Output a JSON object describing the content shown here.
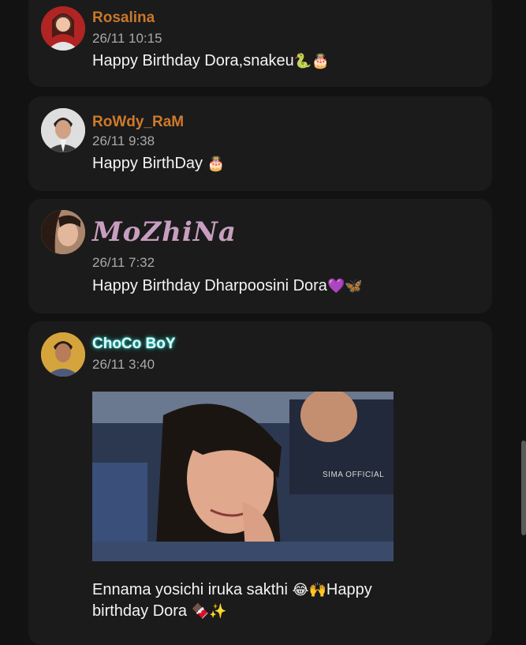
{
  "posts": [
    {
      "username": "Rosalina",
      "username_color": "#c9782c",
      "timestamp": "26/11 10:15",
      "message": "Happy Birthday Dora,snakeu",
      "emojis": "🐍🎂",
      "avatar_icon": "avatar-rosalina"
    },
    {
      "username": "RoWdy_RaM",
      "username_color": "#cf7a2b",
      "timestamp": "26/11 9:38",
      "message": "Happy BirthDay",
      "emojis": "🎂",
      "avatar_icon": "avatar-rowdy-ram"
    },
    {
      "username": "MoZhiNa",
      "username_color": "#c79ec0",
      "timestamp": "26/11 7:32",
      "message": "Happy Birthday Dharpoosini Dora",
      "emojis": "💜🦋",
      "avatar_icon": "avatar-mozhina"
    },
    {
      "username": "ChoCo BoY",
      "username_color": "#9ef3ee",
      "timestamp": "26/11 3:40",
      "media_watermark": "SIMA OFFICIAL",
      "message": "Ennama yosichi iruka sakthi",
      "message_line2": "birthday Dora",
      "emojis_mid": "😂🙌",
      "message_mid_suffix": "Happy",
      "emojis": "🍫✨",
      "avatar_icon": "avatar-choco-boy"
    }
  ]
}
